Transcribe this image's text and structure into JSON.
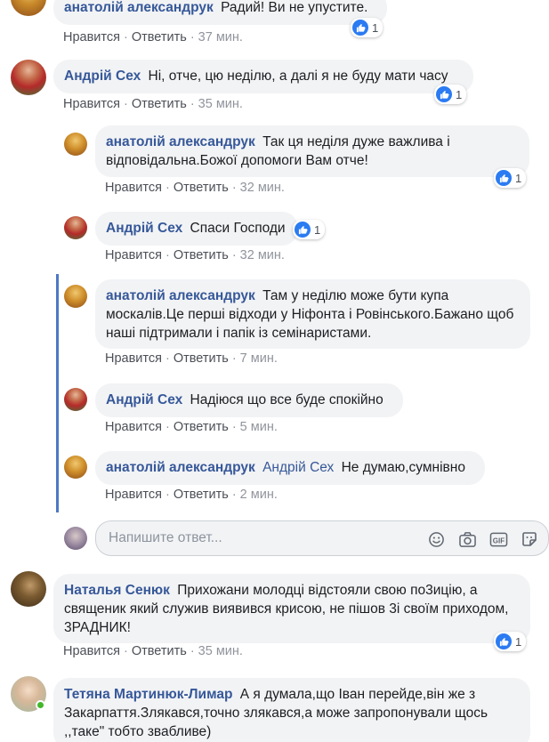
{
  "actions": {
    "like": "Нравится",
    "reply": "Ответить"
  },
  "colors": {
    "name": "#365899",
    "bubble": "#f2f3f5",
    "like_badge": "#2b7bf2",
    "thread_line": "#4e78c4",
    "online": "#42b72a"
  },
  "comments": [
    {
      "author": "анатолій александрук",
      "text": "Радий! Ви не упустите.",
      "time": "37 мин.",
      "likes": "1"
    },
    {
      "author": "Андрій Сех",
      "text": "Ні, отче, цю неділю, а далі я не буду мати часу",
      "time": "35 мин.",
      "likes": "1"
    },
    {
      "author": "анатолій александрук",
      "text": "Так ця неділя дуже важлива і відповідальна.Божої допомоги Вам отче!",
      "time": "32 мин.",
      "likes": "1"
    },
    {
      "author": "Андрій Сех",
      "text": "Спаси Господи",
      "time": "32 мин.",
      "likes": "1"
    },
    {
      "author": "анатолій александрук",
      "text": "Там у неділю може бути купа москалів.Це перші відходи у Ніфонта і Ровінського.Бажано щоб наші підтримали і папік із семінаристами.",
      "time": "7 мин."
    },
    {
      "author": "Андрій Сех",
      "text": "Надіюся що все буде спокійно",
      "time": "5 мин."
    },
    {
      "author": "анатолій александрук",
      "mention": "Андрій Сех",
      "text": "Не думаю,сумнівно",
      "time": "2 мин."
    },
    {
      "author": "Наталья Сенюк",
      "text": "Прихожани молодці відстояли свою по3ицію, а священик який служив виявився крисою, не пішов 3і своїм приходом, 3РАДНИК!",
      "time": "35 мин.",
      "likes": "1"
    },
    {
      "author": "Тетяна Мартинюк-Лимар",
      "text": "А я думала,що Іван перейде,він же з Закарпаття.Злякався,точно злякався,а може запропонували щось ,,таке\" тобто звабливе)"
    }
  ],
  "reply_box": {
    "placeholder": "Напишите ответ..."
  },
  "icons": {
    "thumbs_up": "thumbs-up-icon",
    "emoji": "emoji-icon",
    "camera": "camera-icon",
    "gif": "GIF",
    "sticker": "sticker-icon"
  }
}
